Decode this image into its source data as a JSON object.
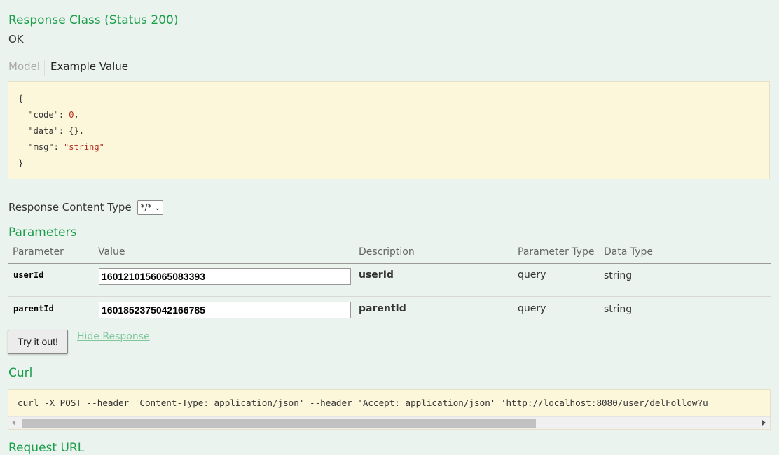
{
  "response_class": {
    "title": "Response Class (Status 200)",
    "status": "OK"
  },
  "model_tabs": {
    "model": "Model",
    "example": "Example Value"
  },
  "example_json": {
    "open": "{",
    "lines": [
      {
        "key": "\"code\"",
        "value": "0",
        "trail": ","
      },
      {
        "key": "\"data\"",
        "value": "{}",
        "trail": ","
      },
      {
        "key": "\"msg\"",
        "value": "\"string\"",
        "trail": ""
      }
    ],
    "close": "}"
  },
  "response_content_type": {
    "label": "Response Content Type",
    "selected": "*/*"
  },
  "parameters": {
    "title": "Parameters",
    "headers": [
      "Parameter",
      "Value",
      "Description",
      "Parameter Type",
      "Data Type"
    ],
    "rows": [
      {
        "name": "userId",
        "value": "1601210156065083393",
        "description": "userId",
        "param_type": "query",
        "data_type": "string"
      },
      {
        "name": "parentId",
        "value": "1601852375042166785",
        "description": "parentId",
        "param_type": "query",
        "data_type": "string"
      }
    ]
  },
  "actions": {
    "try": "Try it out!",
    "hide": "Hide Response"
  },
  "curl": {
    "title": "Curl",
    "command": "curl -X POST --header 'Content-Type: application/json' --header 'Accept: application/json' 'http://localhost:8080/user/delFollow?u"
  },
  "request_url": {
    "title": "Request URL"
  },
  "colors": {
    "accent_green": "#1a9e4a",
    "code_bg": "#fcf6db",
    "page_bg": "#ebf3ee",
    "number_red": "#b3291f"
  }
}
